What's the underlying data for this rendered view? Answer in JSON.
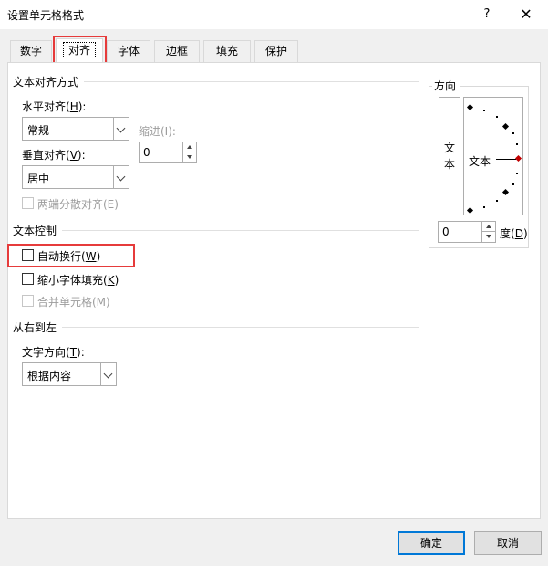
{
  "window": {
    "title": "设置单元格格式",
    "help": "?",
    "close": "✕"
  },
  "tabs": [
    {
      "label": "数字"
    },
    {
      "label": "对齐"
    },
    {
      "label": "字体"
    },
    {
      "label": "边框"
    },
    {
      "label": "填充"
    },
    {
      "label": "保护"
    }
  ],
  "text_alignment": {
    "section": "文本对齐方式",
    "horizontal_label": "水平对齐(",
    "horizontal_key": "H",
    "horizontal_suffix": "):",
    "horizontal_value": "常规",
    "indent_label": "缩进(I):",
    "indent_value": "0",
    "vertical_label": "垂直对齐(",
    "vertical_key": "V",
    "vertical_suffix": "):",
    "vertical_value": "居中",
    "distributed_label": "两端分散对齐(E)"
  },
  "text_control": {
    "section": "文本控制",
    "wrap_label": "自动换行(",
    "wrap_key": "W",
    "wrap_suffix": ")",
    "shrink_label": "缩小字体填充(",
    "shrink_key": "K",
    "shrink_suffix": ")",
    "merge_label": "合并单元格(M)"
  },
  "rtl": {
    "section": "从右到左",
    "direction_label": "文字方向(",
    "direction_key": "T",
    "direction_suffix": "):",
    "direction_value": "根据内容"
  },
  "orientation": {
    "section": "方向",
    "vertical_char_1": "文",
    "vertical_char_2": "本",
    "sample_text": "文本",
    "degree_value": "0",
    "degree_label": "度(",
    "degree_key": "D",
    "degree_suffix": ")"
  },
  "footer": {
    "ok": "确定",
    "cancel": "取消"
  },
  "colors": {
    "highlight": "#e63b3b",
    "primary_border": "#0078d7",
    "marker": "#c00000"
  }
}
